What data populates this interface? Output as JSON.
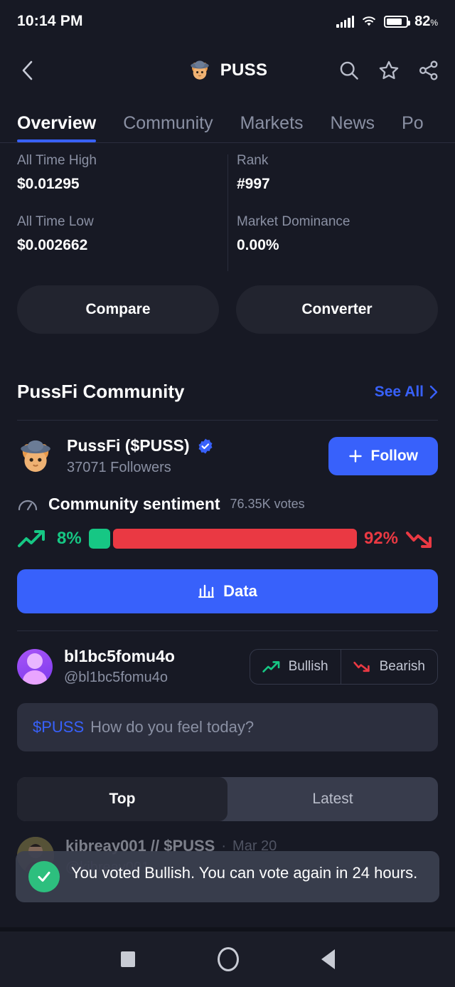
{
  "status_bar": {
    "time": "10:14 PM",
    "battery_percent": "82",
    "battery_unit": "%",
    "icons": [
      "signal-icon",
      "wifi-icon",
      "battery-icon"
    ]
  },
  "header": {
    "back_icon": "chevron-left-icon",
    "coin_symbol": "PUSS",
    "coin_avatar": "puss-cat-avatar",
    "actions": [
      {
        "name": "search-icon",
        "label": "Search"
      },
      {
        "name": "star-icon",
        "label": "Favorite"
      },
      {
        "name": "share-icon",
        "label": "Share"
      }
    ]
  },
  "tabs": [
    {
      "label": "Overview",
      "active": true
    },
    {
      "label": "Community",
      "active": false
    },
    {
      "label": "Markets",
      "active": false
    },
    {
      "label": "News",
      "active": false
    },
    {
      "label": "Po",
      "active": false
    }
  ],
  "stats": {
    "left": [
      {
        "label": "All Time High",
        "value": "$0.01295"
      },
      {
        "label": "All Time Low",
        "value": "$0.002662"
      }
    ],
    "right": [
      {
        "label": "Rank",
        "value": "#997"
      },
      {
        "label": "Market Dominance",
        "value": "0.00%"
      }
    ]
  },
  "action_buttons": [
    {
      "label": "Compare"
    },
    {
      "label": "Converter"
    }
  ],
  "community": {
    "section_title": "PussFi Community",
    "see_all_label": "See All",
    "see_all_icon": "chevron-right-icon",
    "profile": {
      "name": "PussFi ($PUSS)",
      "verified": true,
      "followers": "37071 Followers",
      "follow_label": "Follow",
      "follow_plus_icon": "plus-icon",
      "avatar": "puss-cat-avatar"
    },
    "sentiment": {
      "icon": "gauge-icon",
      "title": "Community sentiment",
      "votes": "76.35K votes",
      "bullish_percent": "8%",
      "bearish_percent": "92%",
      "bullish_value": 8,
      "bearish_value": 92,
      "bullish_icon": "trend-up-icon",
      "bearish_icon": "trend-down-icon",
      "bullish_color": "#16c784",
      "bearish_color": "#ea3943"
    },
    "data_button": {
      "label": "Data",
      "icon": "bar-chart-icon",
      "color": "#3861fb"
    },
    "vote_row": {
      "username": "bl1bc5fomu4o",
      "handle": "@bl1bc5fomu4o",
      "avatar": "user-avatar",
      "bullish_label": "Bullish",
      "bearish_label": "Bearish",
      "bullish_icon": "trend-up-icon",
      "bearish_icon": "trend-down-icon"
    },
    "post_input": {
      "ticker": "$PUSS",
      "placeholder": "How do you feel today?"
    },
    "feed_tabs": [
      {
        "label": "Top",
        "active": true
      },
      {
        "label": "Latest",
        "active": false
      }
    ],
    "feed_posts": [
      {
        "name": "kibreay001 // $PUSS",
        "separator": "·",
        "date": "Mar 20",
        "handle": "@kibreay001",
        "avatar": "kibreay-avatar"
      }
    ]
  },
  "toast": {
    "icon": "check-circle-icon",
    "message": "You voted Bullish. You can vote again in 24 hours."
  },
  "android_nav": [
    {
      "name": "recents-button",
      "shape": "square"
    },
    {
      "name": "home-button",
      "shape": "circle"
    },
    {
      "name": "back-button",
      "shape": "triangle"
    }
  ],
  "theme": {
    "background": "#171924",
    "accent_blue": "#3861fb",
    "green": "#16c784",
    "red": "#ea3943",
    "muted_text": "#8a90a3"
  }
}
